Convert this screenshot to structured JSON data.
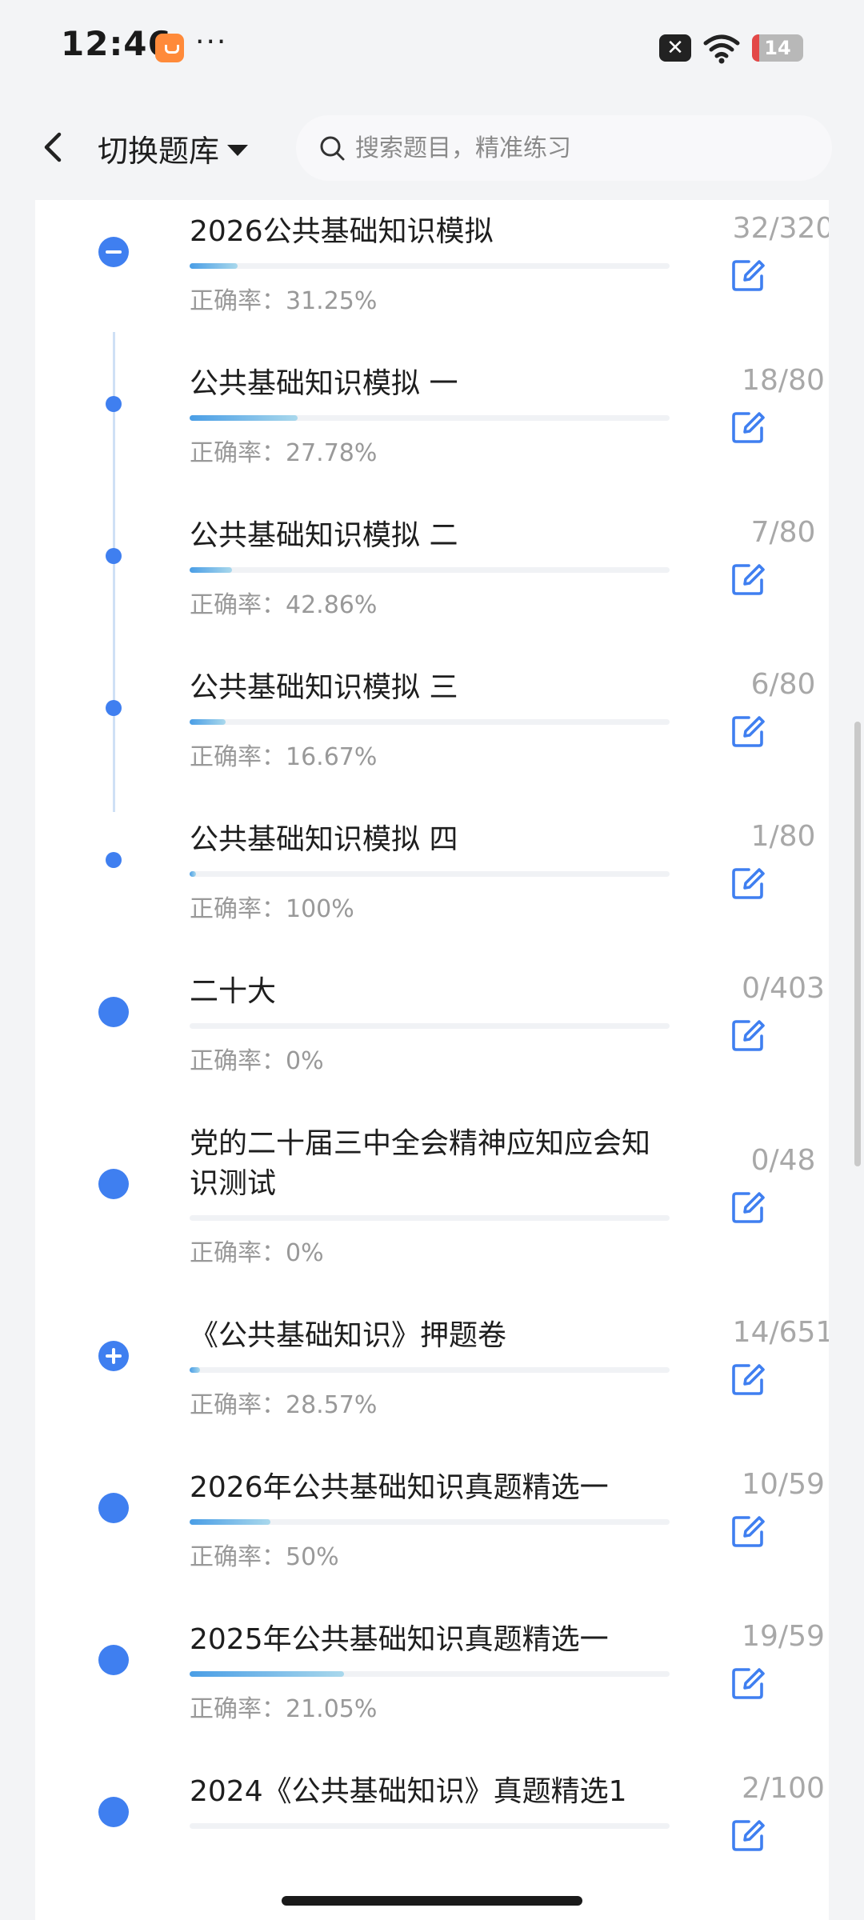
{
  "status_bar": {
    "time": "12:46",
    "battery": "14",
    "battery_level": 0.14,
    "close_glyph": "✕"
  },
  "header": {
    "switch_label": "切换题库",
    "search_placeholder": "搜索题目，精准练习"
  },
  "accuracy_prefix": "正确率：",
  "items": [
    {
      "title": "",
      "accuracy": "0%",
      "count": "",
      "progress": 0,
      "dot": "none"
    },
    {
      "title": "2026公共基础知识模拟",
      "accuracy": "31.25%",
      "count": "32/320",
      "progress": 0.1,
      "dot": "minus"
    },
    {
      "title": "公共基础知识模拟 一",
      "accuracy": "27.78%",
      "count": "18/80",
      "progress": 0.225,
      "dot": "small"
    },
    {
      "title": "公共基础知识模拟 二",
      "accuracy": "42.86%",
      "count": "7/80",
      "progress": 0.0875,
      "dot": "small"
    },
    {
      "title": "公共基础知识模拟 三",
      "accuracy": "16.67%",
      "count": "6/80",
      "progress": 0.075,
      "dot": "small"
    },
    {
      "title": "公共基础知识模拟 四",
      "accuracy": "100%",
      "count": "1/80",
      "progress": 0.0125,
      "dot": "small"
    },
    {
      "title": "二十大",
      "accuracy": "0%",
      "count": "0/403",
      "progress": 0,
      "dot": "big"
    },
    {
      "title": "党的二十届三中全会精神应知应会知识测试",
      "accuracy": "0%",
      "count": "0/48",
      "progress": 0,
      "dot": "big"
    },
    {
      "title": "《公共基础知识》押题卷",
      "accuracy": "28.57%",
      "count": "14/651",
      "progress": 0.0215,
      "dot": "plus"
    },
    {
      "title": "2026年公共基础知识真题精选一",
      "accuracy": "50%",
      "count": "10/59",
      "progress": 0.169,
      "dot": "big"
    },
    {
      "title": "2025年公共基础知识真题精选一",
      "accuracy": "21.05%",
      "count": "19/59",
      "progress": 0.322,
      "dot": "big"
    },
    {
      "title": "2024《公共基础知识》真题精选1",
      "accuracy": "",
      "count": "2/100",
      "progress": 0,
      "dot": "big"
    }
  ]
}
